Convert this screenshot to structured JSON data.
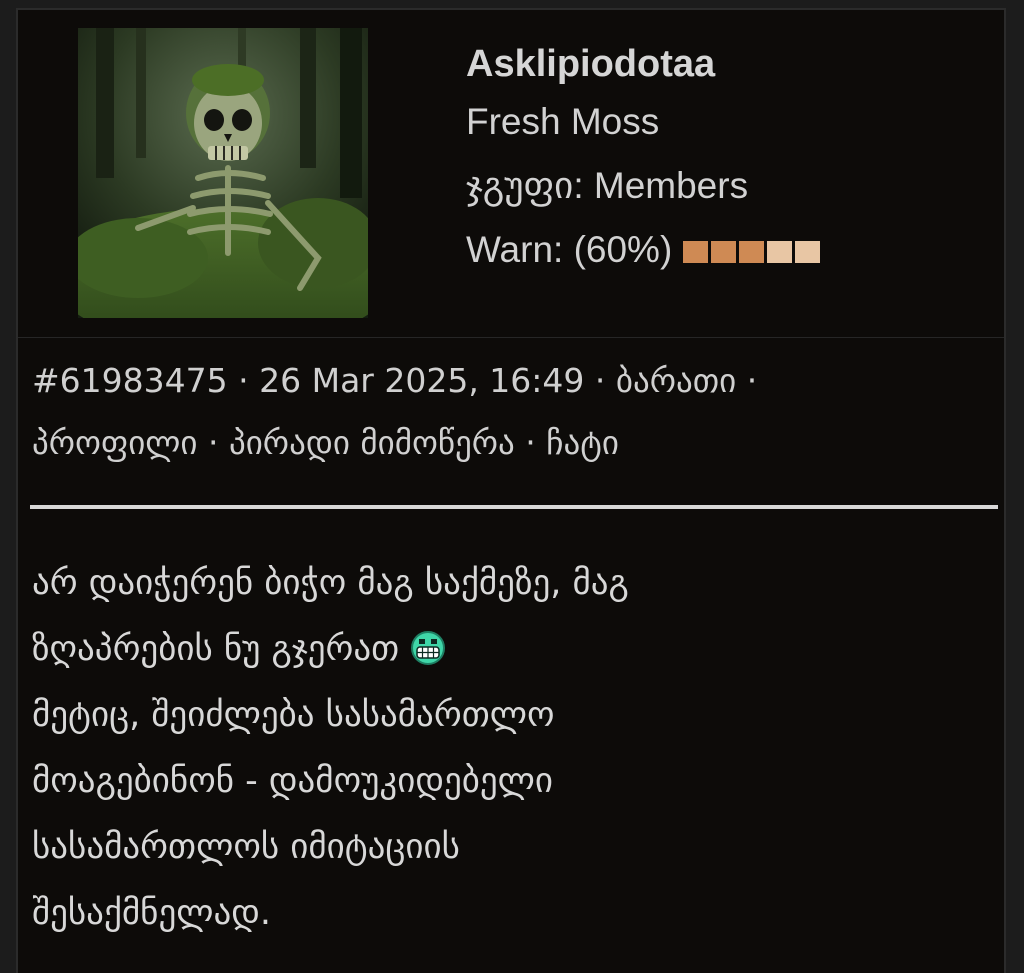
{
  "profile": {
    "username": "Asklipiodotaa",
    "title": "Fresh Moss",
    "group_line": "ჯგუფი: Members",
    "warn_line": "Warn: (60%)",
    "warn_level_percent": 60,
    "warn_boxes": [
      "#cf8a54",
      "#cf8a54",
      "#cf8a54",
      "#e8c6a4",
      "#e8c6a4"
    ],
    "avatar_icon": "moss-skeleton-avatar"
  },
  "meta": {
    "post_id": "#61983475",
    "date": "26 Mar 2025, 16:49",
    "link_card": "ბარათი",
    "link_profile": "პროფილი",
    "link_pm": "პირადი მიმოწერა",
    "link_chat": "ჩატი",
    "separator": " · "
  },
  "post": {
    "lines": [
      "არ დაიჭერენ ბიჭო მაგ საქმეზე, მაგ",
      "ზღაპრების ნუ გჯერათ",
      "მეტიც, შეიძლება სასამართლო",
      "მოაგებინონ - დამოუკიდებელი",
      "სასამართლოს იმიტაციის",
      "შესაქმნელად."
    ],
    "emoji_icon": "grimace-smiley-icon"
  },
  "colors": {
    "background": "#0d0b09",
    "text": "#d8d8d8",
    "divider": "#d8d8d8",
    "emoji": "#3fd6a8"
  }
}
